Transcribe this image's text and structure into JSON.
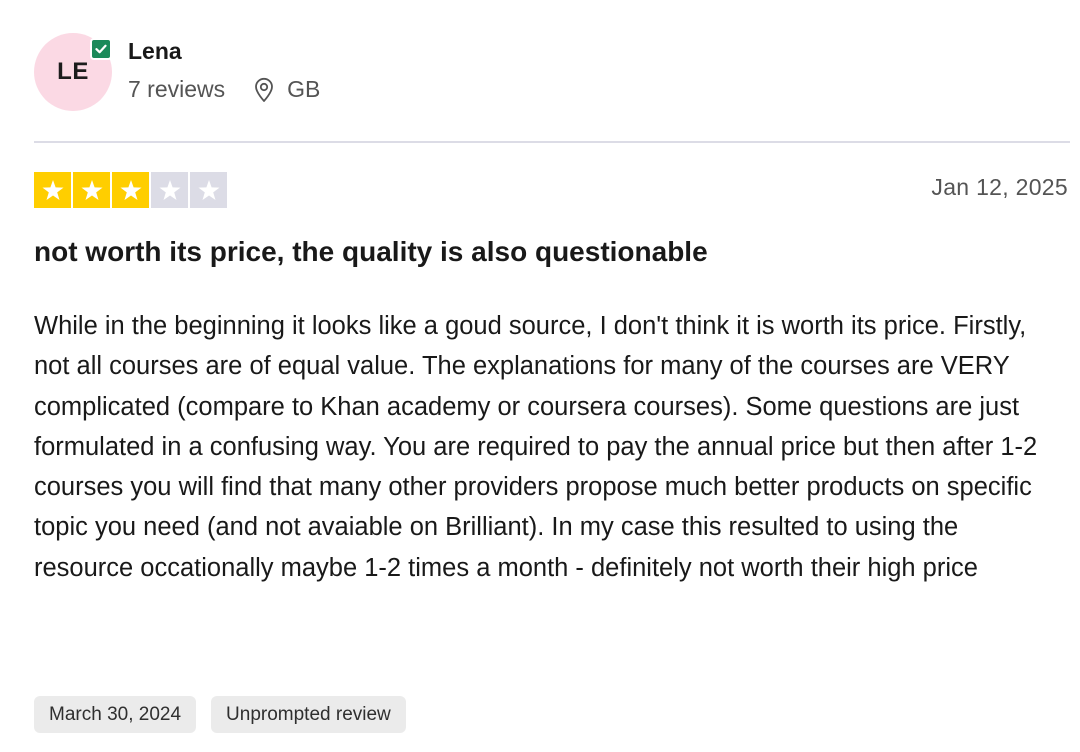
{
  "reviewer": {
    "initials": "LE",
    "name": "Lena",
    "reviews_count": "7 reviews",
    "location": "GB"
  },
  "review": {
    "rating": 3,
    "max_rating": 5,
    "date": "Jan 12, 2025",
    "title": "not worth its price, the quality is also questionable",
    "body": "While in the beginning it looks like a goud source, I don't think it is worth its price. Firstly, not all courses are of equal value. The explanations for many of the courses are VERY complicated (compare to Khan academy or coursera courses). Some questions are just formulated in a confusing way. You are required to pay the annual price but then after 1-2 courses you will find that many other providers propose much better products on specific topic you need (and not avaiable on Brilliant). In my case this resulted to using the resource occationally maybe 1-2 times a month - definitely not worth their high price",
    "experience_date": "March 30, 2024",
    "review_type": "Unprompted review"
  },
  "colors": {
    "star_on": "#ffce00",
    "star_off": "#dcdce6",
    "avatar_bg": "#fbd9e4",
    "verified_badge": "#1b8a5a"
  },
  "icons": {
    "verified": "check-badge-icon",
    "location": "map-pin-icon",
    "star": "star-icon"
  }
}
